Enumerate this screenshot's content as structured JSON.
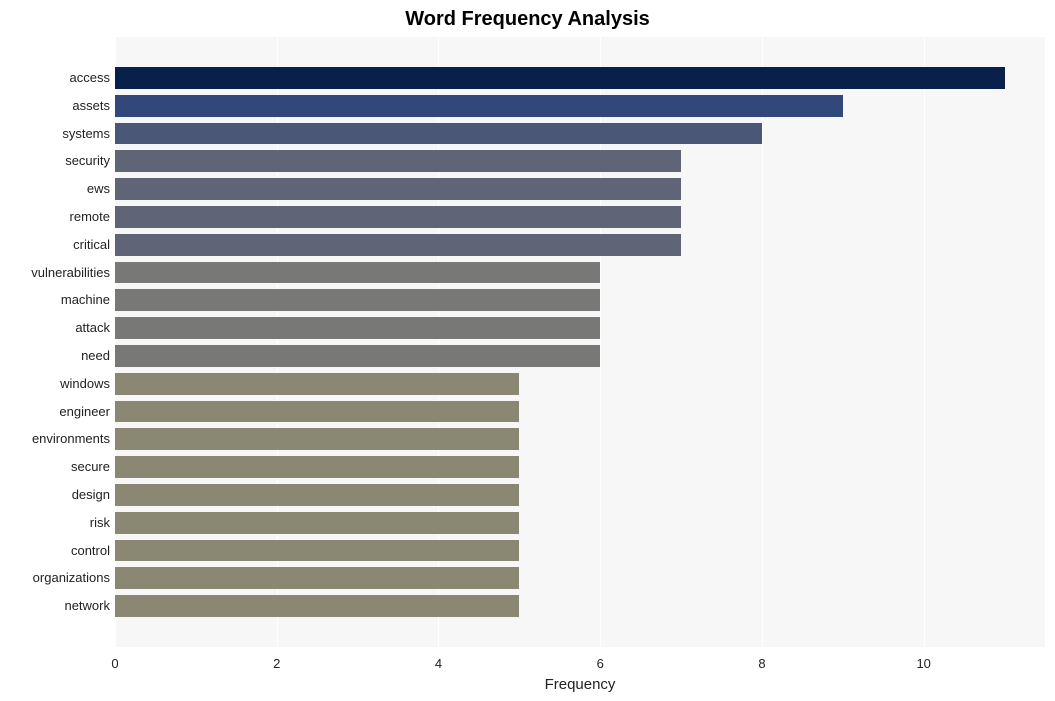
{
  "chart_data": {
    "type": "bar",
    "orientation": "horizontal",
    "title": "Word Frequency Analysis",
    "xlabel": "Frequency",
    "ylabel": "",
    "xlim": [
      0,
      11.5
    ],
    "x_ticks": [
      0,
      2,
      4,
      6,
      8,
      10
    ],
    "categories": [
      "access",
      "assets",
      "systems",
      "security",
      "ews",
      "remote",
      "critical",
      "vulnerabilities",
      "machine",
      "attack",
      "need",
      "windows",
      "engineer",
      "environments",
      "secure",
      "design",
      "risk",
      "control",
      "organizations",
      "network"
    ],
    "values": [
      11,
      9,
      8,
      7,
      7,
      7,
      7,
      6,
      6,
      6,
      6,
      5,
      5,
      5,
      5,
      5,
      5,
      5,
      5,
      5
    ],
    "colors": [
      "#08204a",
      "#33487a",
      "#4b5777",
      "#5f6576",
      "#5f6576",
      "#5f6576",
      "#5f6576",
      "#787876",
      "#787876",
      "#787876",
      "#787876",
      "#8a8873",
      "#8a8873",
      "#8a8873",
      "#8a8873",
      "#8a8873",
      "#8a8873",
      "#8a8873",
      "#8a8873",
      "#8a8873"
    ]
  }
}
